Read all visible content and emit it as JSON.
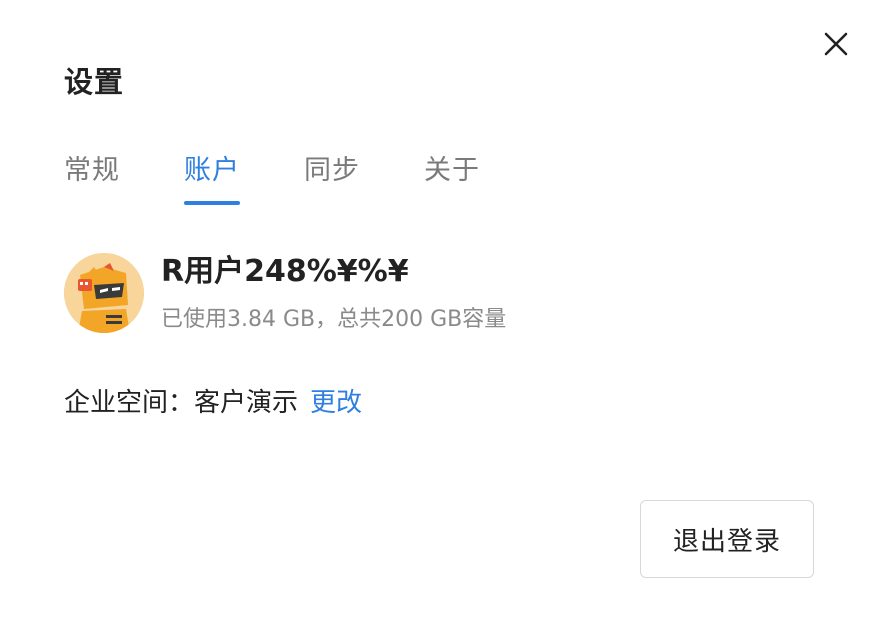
{
  "dialog": {
    "title": "设置",
    "close_icon": "close-icon"
  },
  "tabs": [
    {
      "label": "常规",
      "active": false
    },
    {
      "label": "账户",
      "active": true
    },
    {
      "label": "同步",
      "active": false
    },
    {
      "label": "关于",
      "active": false
    }
  ],
  "account": {
    "avatar": "robot-avatar",
    "user_name": "R用户248%¥%¥",
    "storage_text": "已使用3.84 GB，总共200 GB容量"
  },
  "organization": {
    "label": "企业空间：",
    "value": "客户演示",
    "change_label": "更改"
  },
  "actions": {
    "logout_label": "退出登录"
  },
  "colors": {
    "accent": "#2f7fe0",
    "text": "#222222",
    "muted": "#7a7a7a"
  }
}
